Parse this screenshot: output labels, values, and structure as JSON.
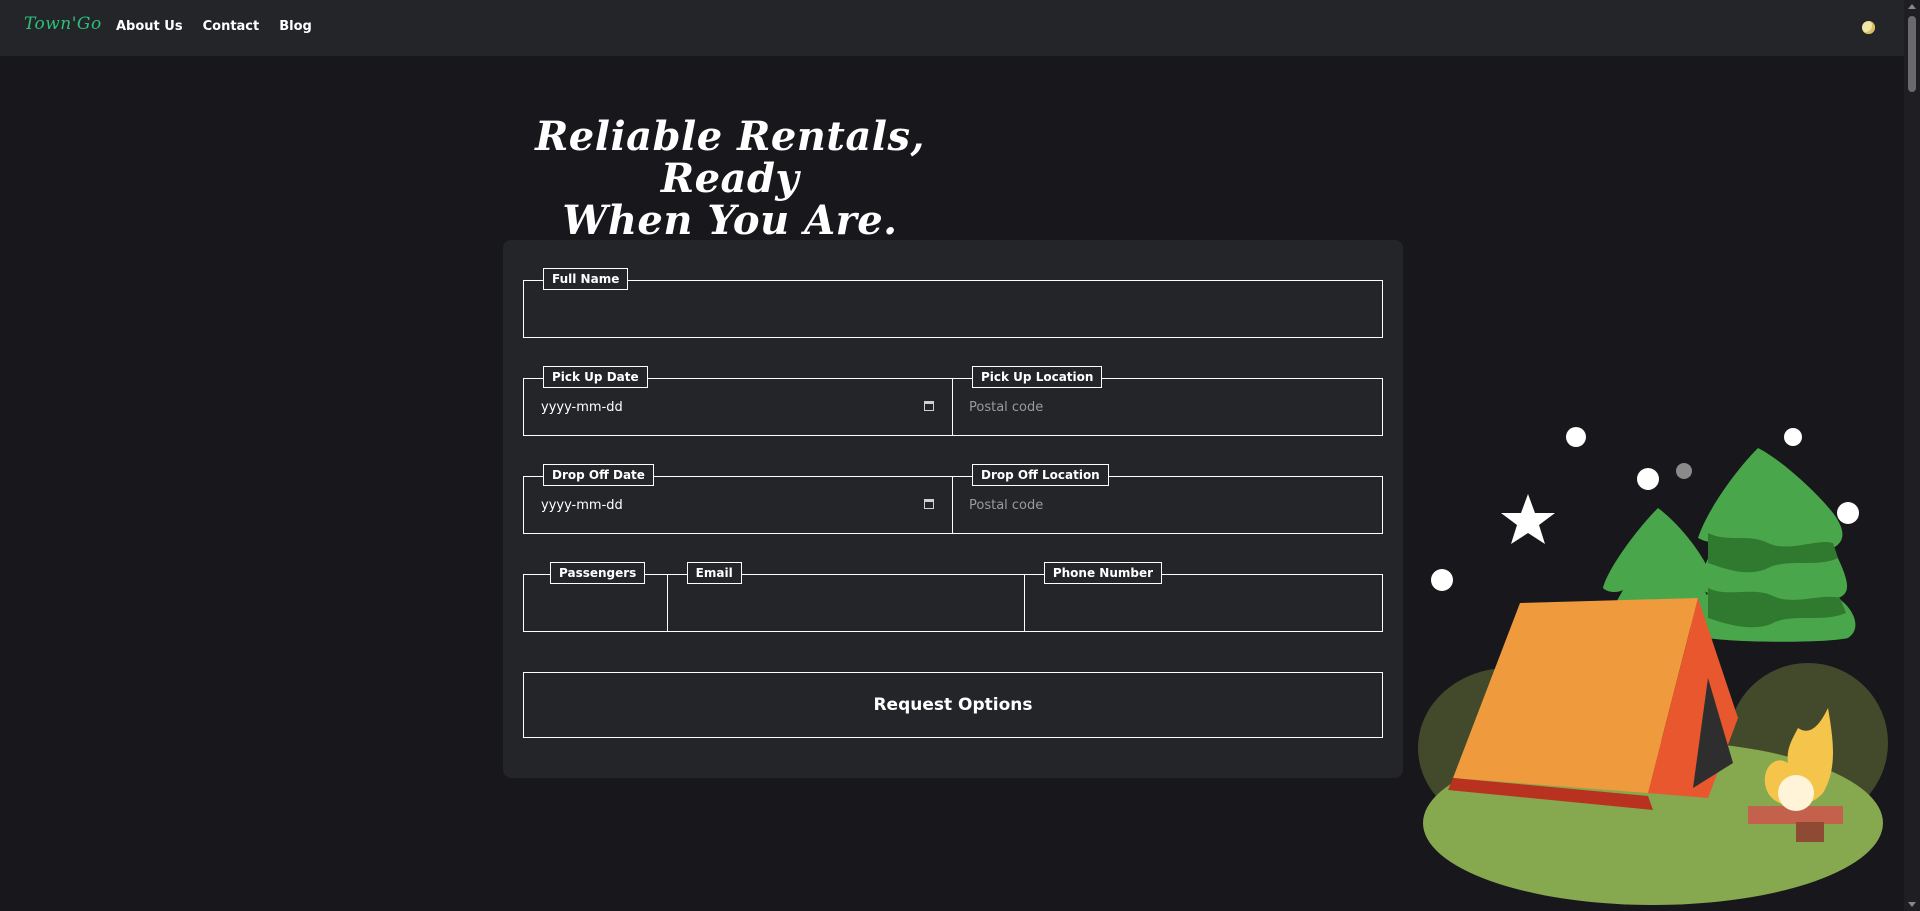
{
  "navbar": {
    "logo": "Town'Go",
    "links": [
      "About Us",
      "Contact",
      "Blog"
    ]
  },
  "hero": {
    "title_line1": "Reliable Rentals, Ready",
    "title_line2": "When You Are."
  },
  "form": {
    "full_name": {
      "label": "Full Name",
      "value": ""
    },
    "pickup_date": {
      "label": "Pick Up Date",
      "placeholder": "yyyy-mm-dd"
    },
    "pickup_location": {
      "label": "Pick Up Location",
      "placeholder": "Postal code"
    },
    "dropoff_date": {
      "label": "Drop Off Date",
      "placeholder": "yyyy-mm-dd"
    },
    "dropoff_location": {
      "label": "Drop Off Location",
      "placeholder": "Postal code"
    },
    "passengers": {
      "label": "Passengers",
      "value": ""
    },
    "email": {
      "label": "Email",
      "value": ""
    },
    "phone": {
      "label": "Phone Number",
      "value": ""
    },
    "submit_label": "Request Options"
  },
  "colors": {
    "page_bg": "#18181c",
    "card_bg": "#242529",
    "logo_green": "#2cc07a",
    "tent_orange": "#f09a3e",
    "tree_green": "#4aa64a",
    "grass": "#86a84e"
  },
  "icons": {
    "theme": "moon-icon",
    "calendar": "calendar-icon",
    "illustration": "campsite-illustration"
  }
}
